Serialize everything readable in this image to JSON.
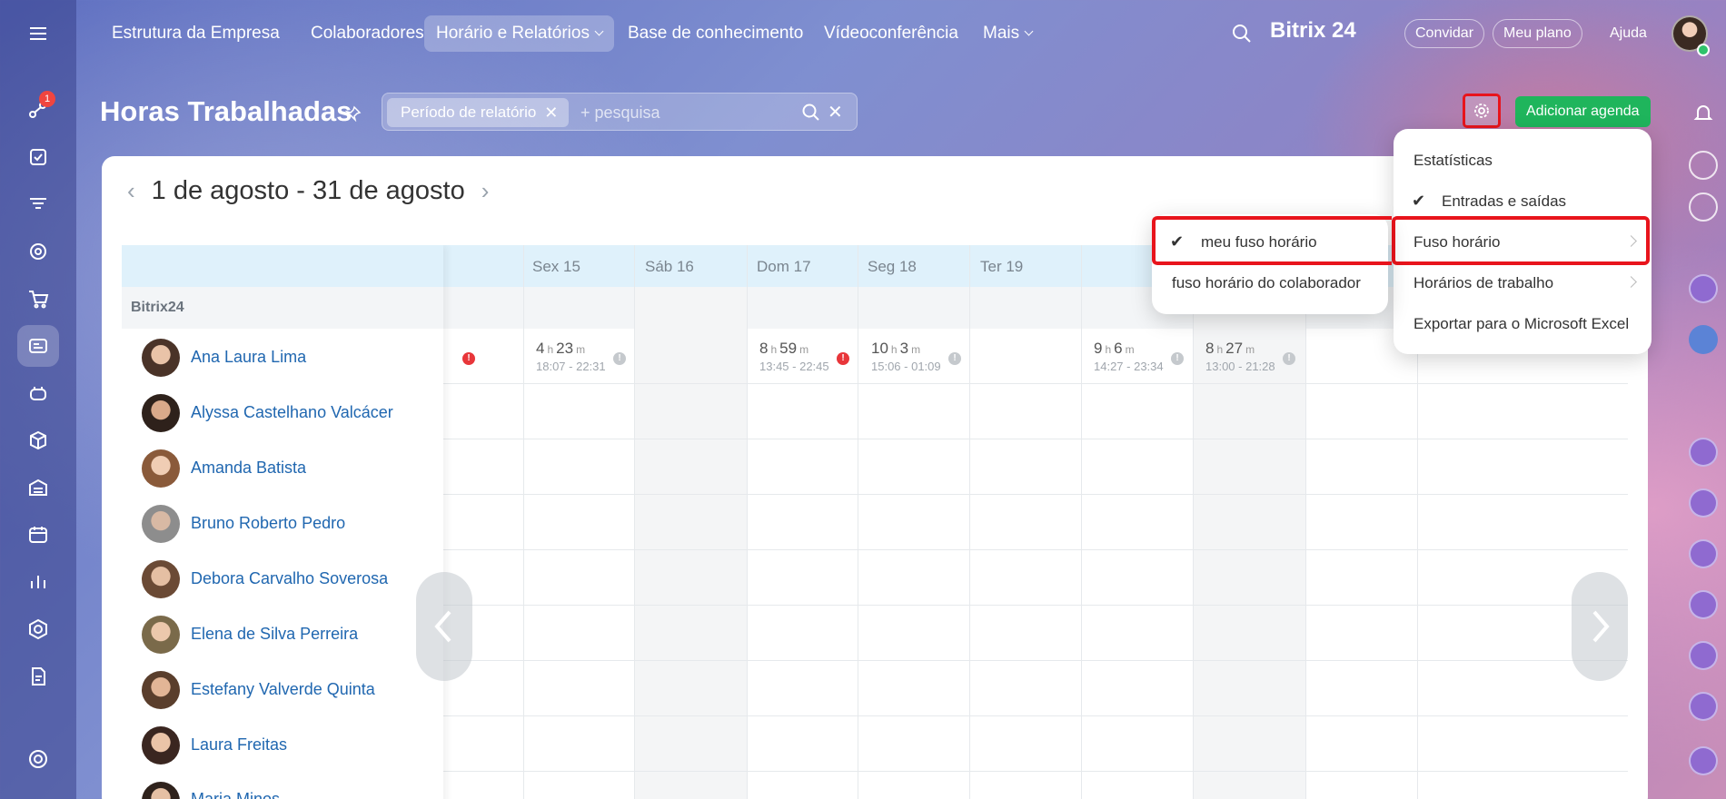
{
  "nav": {
    "items": [
      "Estrutura da Empresa",
      "Colaboradores",
      "Horário e Relatórios",
      "Base de conhecimento",
      "Vídeoconferência",
      "Mais"
    ],
    "brand": "Bitrix 24",
    "invite": "Convidar",
    "plan": "Meu plano",
    "help": "Ajuda"
  },
  "sidebar": {
    "badge": "1"
  },
  "page": {
    "title": "Horas Trabalhadas",
    "filter_chip": "Período de relatório",
    "search_placeholder": "+ pesquisa",
    "add_button": "Adicionar agenda",
    "period": "1 de agosto - 31 de agosto"
  },
  "grid": {
    "columns": [
      "Sex 15",
      "Sáb 16",
      "Dom 17",
      "Seg 18",
      "Ter 19"
    ],
    "group": "Bitrix24",
    "employees": [
      "Ana Laura Lima",
      "Alyssa Castelhano Valcácer",
      "Amanda Batista",
      "Bruno Roberto Pedro",
      "Debora Carvalho Soverosa",
      "Elena de Silva Perreira",
      "Estefany Valverde Quinta",
      "Laura Freitas",
      "Maria Minos"
    ],
    "ana_times": [
      {
        "h": "4",
        "m": "23",
        "range": "18:07 - 22:31"
      },
      {
        "h": "8",
        "m": "59",
        "range": "13:45 - 22:45"
      },
      {
        "h": "10",
        "m": "3",
        "range": "15:06 - 01:09"
      },
      {
        "h": "9",
        "m": "6",
        "range": "14:27 - 23:34"
      },
      {
        "h": "8",
        "m": "27",
        "range": "13:00 - 21:28"
      }
    ],
    "unit_h": "h",
    "unit_m": "m"
  },
  "settings_menu": {
    "items": [
      "Estatísticas",
      "Entradas e saídas",
      "Fuso horário",
      "Horários de trabalho",
      "Exportar para o Microsoft Excel"
    ]
  },
  "timezone_menu": {
    "items": [
      "meu fuso horário",
      "fuso horário do colaborador"
    ]
  },
  "colors": {
    "accent_green": "#1fb55c",
    "highlight_red": "#e8141c",
    "link_blue": "#2067b0"
  }
}
